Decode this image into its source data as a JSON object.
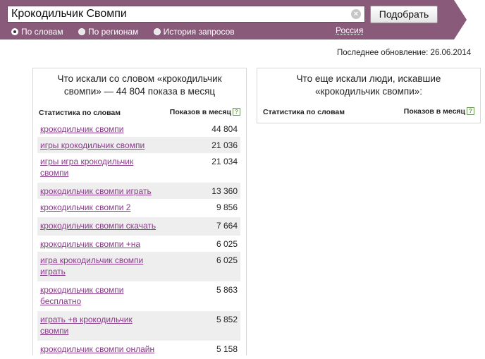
{
  "search": {
    "query": "Крокодильчик Свомпи",
    "clear_icon": "×",
    "submit_label": "Подобрать",
    "modes": [
      {
        "label": "По словам",
        "selected": true
      },
      {
        "label": "По регионам",
        "selected": false
      },
      {
        "label": "История запросов",
        "selected": false
      }
    ],
    "region": "Россия"
  },
  "updated_label": "Последнее обновление: 26.06.2014",
  "left_panel": {
    "title": "Что искали со словом «крокодильчик свомпи» — 44 804 показа в месяц",
    "col_phrase": "Статистика по словам",
    "col_count": "Показов в месяц",
    "help_icon": "?",
    "rows": [
      {
        "phrase": "крокодильчик свомпи",
        "count": "44 804"
      },
      {
        "phrase": "игры крокодильчик свомпи",
        "count": "21 036"
      },
      {
        "phrase": "игры игра крокодильчик свомпи",
        "count": "21 034"
      },
      {
        "phrase": "крокодильчик свомпи играть",
        "count": "13 360"
      },
      {
        "phrase": "крокодильчик свомпи 2",
        "count": "9 856"
      },
      {
        "phrase": "крокодильчик свомпи скачать",
        "count": "7 664"
      },
      {
        "phrase": "крокодильчик свомпи +на",
        "count": "6 025"
      },
      {
        "phrase": "игра крокодильчик свомпи играть",
        "count": "6 025"
      },
      {
        "phrase": "крокодильчик свомпи бесплатно",
        "count": "5 863"
      },
      {
        "phrase": "играть +в крокодильчик свомпи",
        "count": "5 852"
      },
      {
        "phrase": "крокодильчик свомпи онлайн",
        "count": "5 158"
      }
    ]
  },
  "right_panel": {
    "title": "Что еще искали люди, искавшие «крокодильчик свомпи»:",
    "col_phrase": "Статистика по словам",
    "col_count": "Показов в месяц",
    "help_icon": "?"
  },
  "colors": {
    "banner": "#8a5a7a",
    "link": "#8a3a8a",
    "row_alt": "#eeeeee"
  }
}
